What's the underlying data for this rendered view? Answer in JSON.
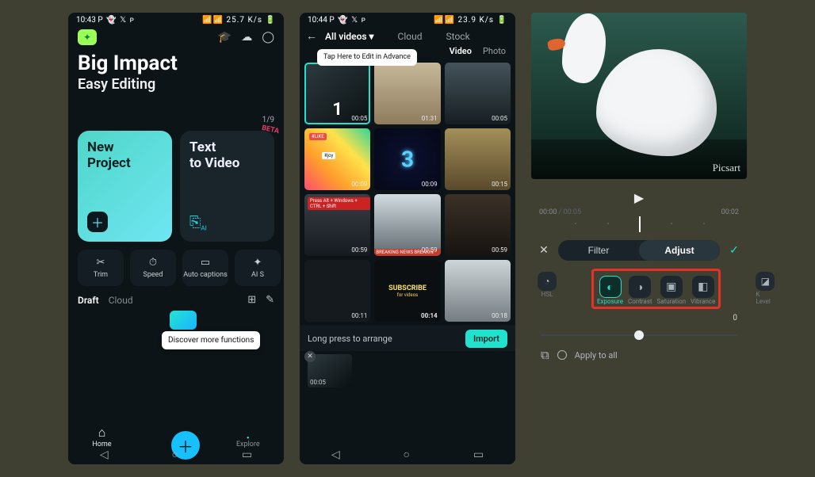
{
  "s1": {
    "status": {
      "time": "10:43",
      "apps": "P 👻 𝕏 ᴘ",
      "right": "📶📶 25.7 K/s 🔋"
    },
    "hero": {
      "title": "Big Impact",
      "subtitle": "Easy Editing",
      "pager": "1/9"
    },
    "card_primary": "New\nProject",
    "card_dark": "Text\nto Video",
    "beta": "BETA",
    "tools": [
      {
        "icon": "✂",
        "label": "Trim"
      },
      {
        "icon": "⏱",
        "label": "Speed"
      },
      {
        "icon": "▭",
        "label": "Auto captions"
      },
      {
        "icon": "✦",
        "label": "AI S"
      }
    ],
    "tab_active": "Draft",
    "tab_muted": "Cloud",
    "discover": "Discover more functions",
    "nav": {
      "home": "Home",
      "explore": "Explore"
    }
  },
  "s2": {
    "status": {
      "time": "10:44",
      "apps": "P 👻 𝕏 ᴘ",
      "right": "📶📶 23.9 K/s 🔋"
    },
    "tabs": {
      "main": "All videos ▾",
      "cloud": "Cloud",
      "stock": "Stock"
    },
    "tip": "Tap Here to Edit in Advance",
    "subtabs": {
      "video": "Video",
      "photo": "Photo"
    },
    "thumbs": [
      {
        "dur": "00:05",
        "style": "th1",
        "selected": true,
        "selnum": "1"
      },
      {
        "dur": "01:31",
        "style": "th2"
      },
      {
        "dur": "00:05",
        "style": "th3"
      },
      {
        "dur": "00:09",
        "style": "th4"
      },
      {
        "dur": "00:09",
        "style": "th5",
        "neon": "3"
      },
      {
        "dur": "00:15",
        "style": "th6"
      },
      {
        "dur": "00:59",
        "style": "th7"
      },
      {
        "dur": "00:59",
        "style": "th8"
      },
      {
        "dur": "00:59",
        "style": "th9"
      },
      {
        "dur": "00:11",
        "style": "th10"
      },
      {
        "dur": "00:14",
        "style": "th11"
      },
      {
        "dur": "00:18",
        "style": "th12"
      }
    ],
    "sub_label": "SUBSCRIBE",
    "sub_sub": "for videos",
    "hint": "Long press to arrange",
    "import": "Import",
    "mini_dur": "00:05"
  },
  "s3": {
    "watermark": "Picsart",
    "time": {
      "cur": "00:00",
      "total": "/ 00:05",
      "end": "00:02"
    },
    "tabs": {
      "filter": "Filter",
      "adjust": "Adjust"
    },
    "side": {
      "left": "HSL",
      "right": "K Level"
    },
    "options": [
      {
        "icon": "◐",
        "label": "Exposure",
        "sel": true
      },
      {
        "icon": "◑",
        "label": "Contrast"
      },
      {
        "icon": "▣",
        "label": "Saturation"
      },
      {
        "icon": "◧",
        "label": "Vibrance"
      }
    ],
    "value": "0",
    "apply": "Apply to all"
  }
}
